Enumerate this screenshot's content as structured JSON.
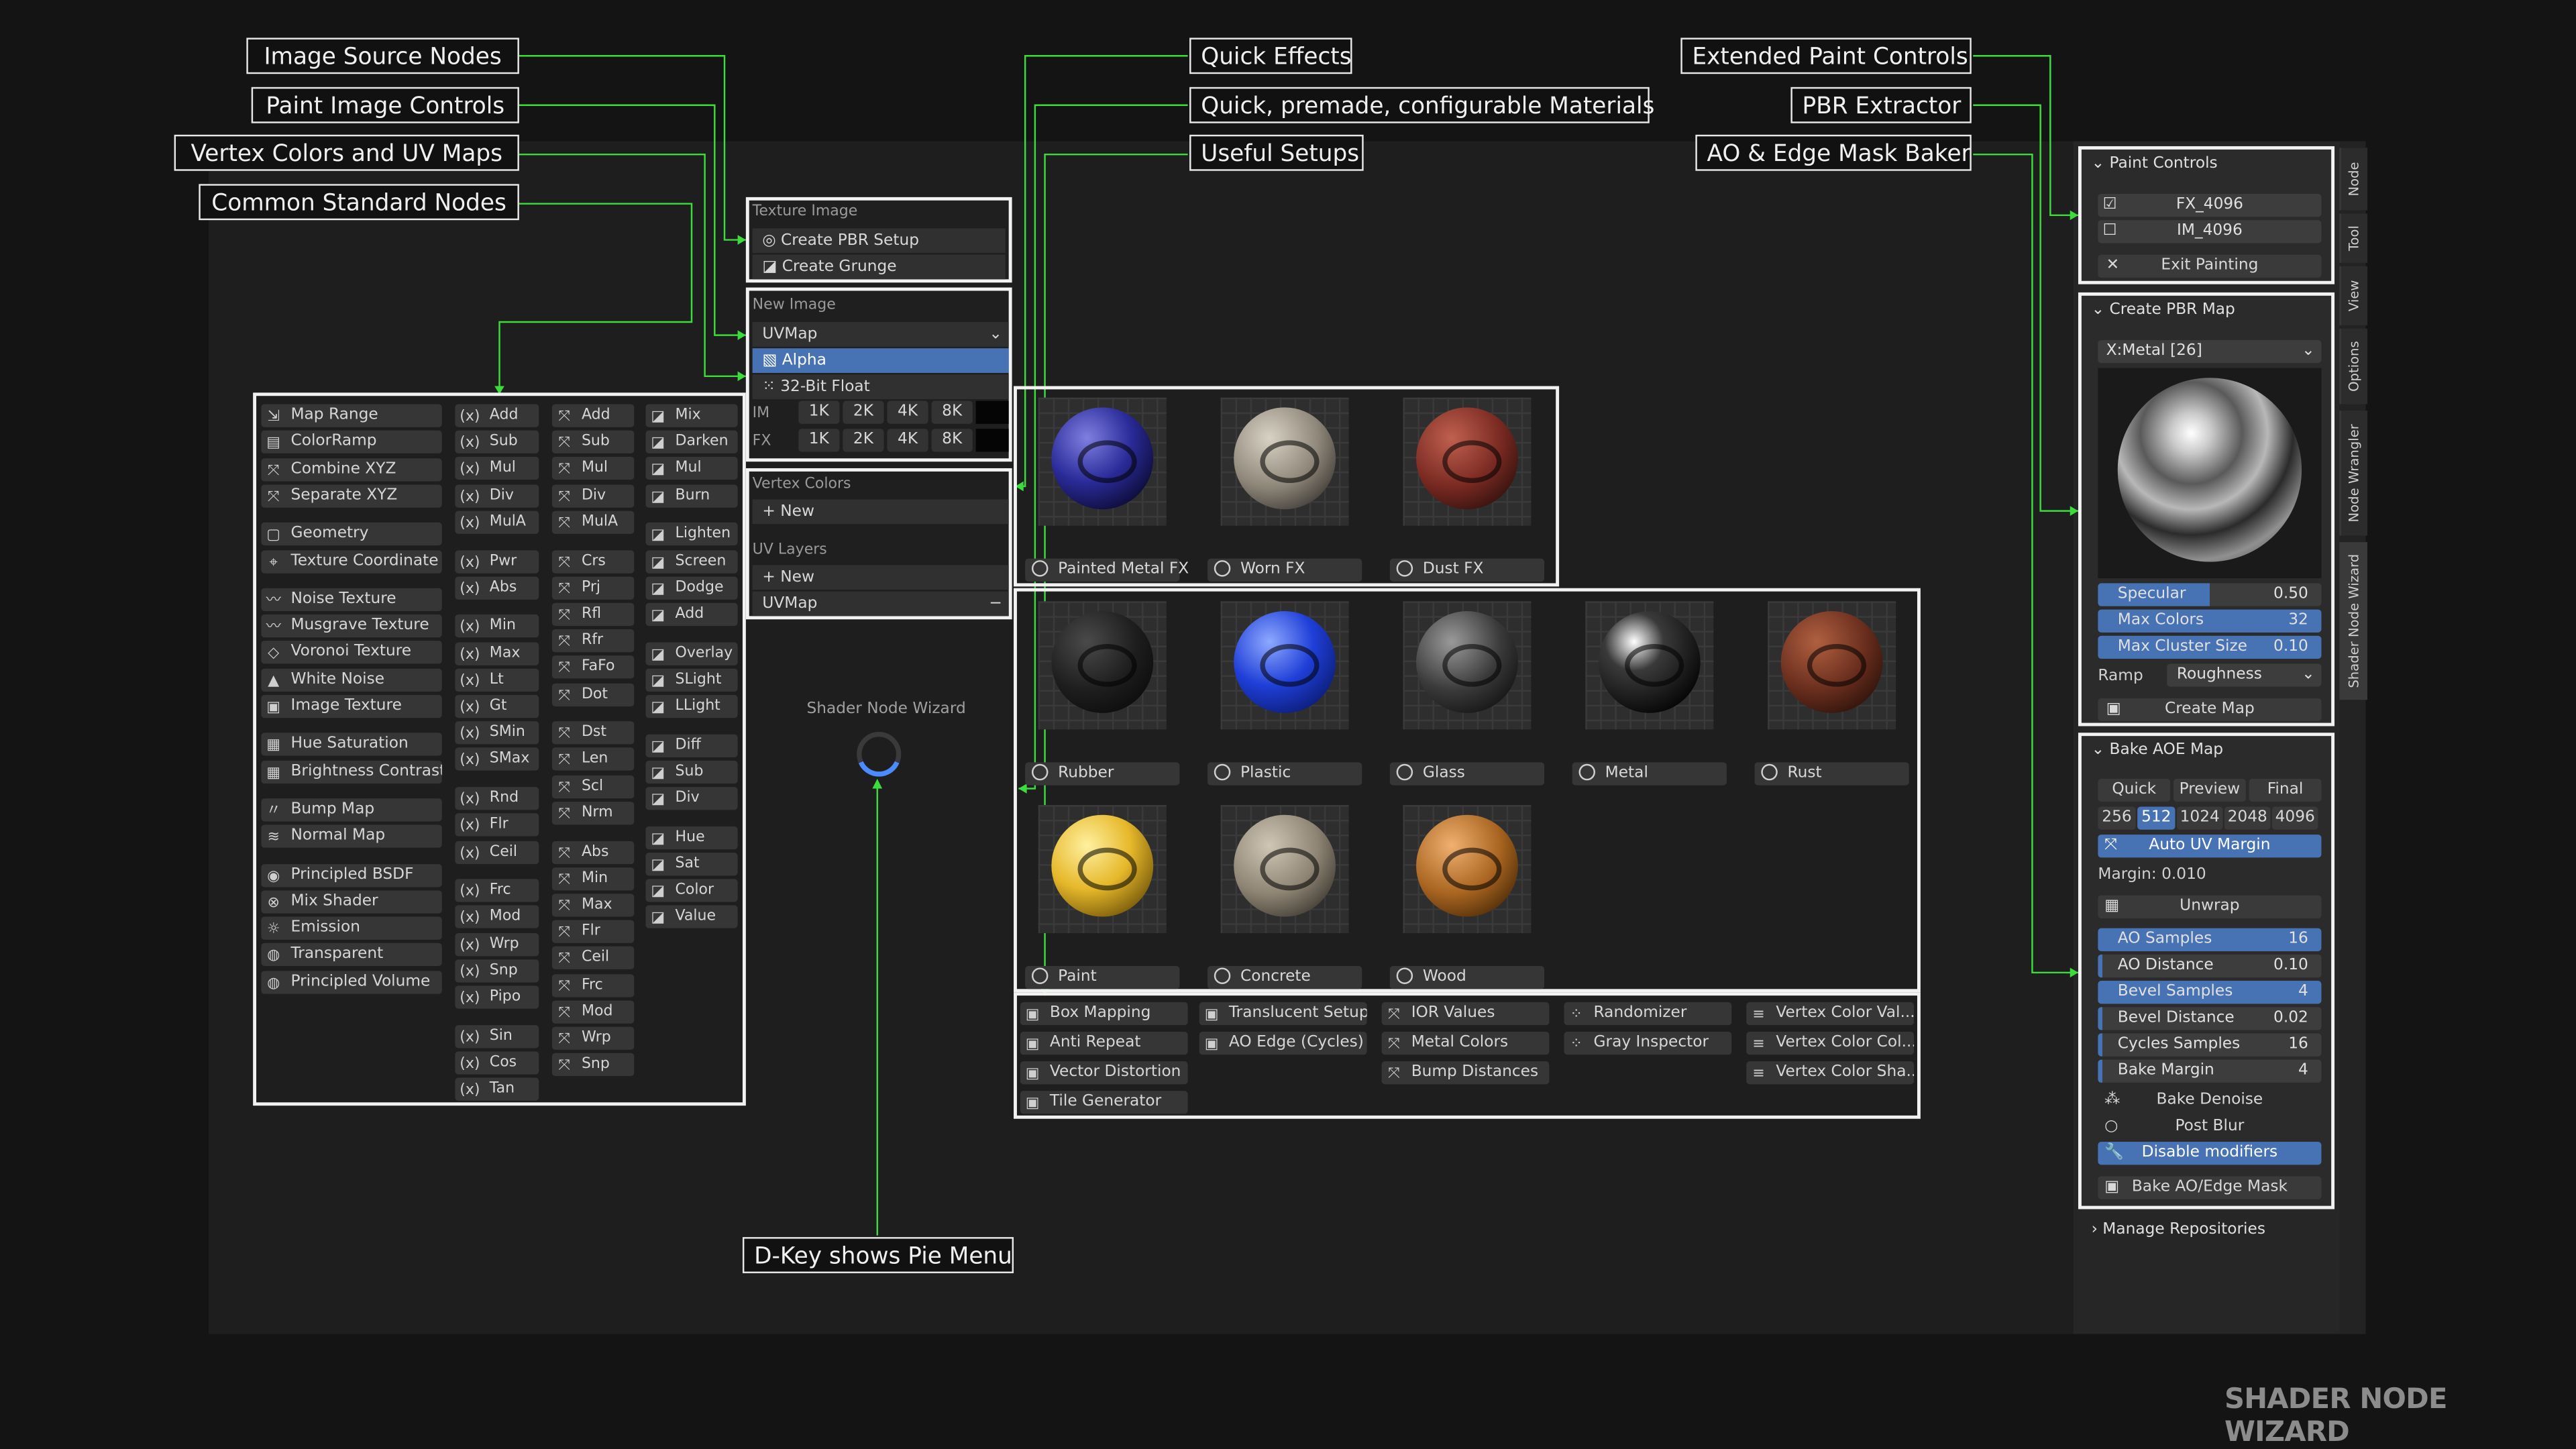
{
  "callouts": {
    "image_source_nodes": "Image Source Nodes",
    "paint_image_controls": "Paint Image Controls",
    "vertex_colors_uv_maps": "Vertex Colors and UV Maps",
    "common_standard_nodes": "Common Standard Nodes",
    "quick_effects": "Quick Effects",
    "quick_materials": "Quick, premade, configurable Materials",
    "useful_setups": "Useful Setups",
    "extended_paint_controls": "Extended Paint Controls",
    "pbr_extractor": "PBR Extractor",
    "ao_edge_mask_baker": "AO & Edge Mask Baker",
    "d_key_pie": "D-Key shows Pie Menu"
  },
  "nodes_col1": [
    "Map Range",
    "ColorRamp",
    "Combine XYZ",
    "Separate XYZ",
    "Geometry",
    "Texture Coordinate",
    "Noise Texture",
    "Musgrave Texture",
    "Voronoi Texture",
    "White Noise",
    "Image Texture",
    "Hue Saturation",
    "Brightness Contrast",
    "Bump Map",
    "Normal Map",
    "Principled BSDF",
    "Mix Shader",
    "Emission",
    "Transparent",
    "Principled Volume"
  ],
  "nodes_col2": [
    "Add",
    "Sub",
    "Mul",
    "Div",
    "MulA",
    "Pwr",
    "Abs",
    "Min",
    "Max",
    "Lt",
    "Gt",
    "SMin",
    "SMax",
    "Rnd",
    "Flr",
    "Ceil",
    "Frc",
    "Mod",
    "Wrp",
    "Snp",
    "Pipo",
    "Sin",
    "Cos",
    "Tan"
  ],
  "nodes_col3": [
    "Add",
    "Sub",
    "Mul",
    "Div",
    "MulA",
    "Crs",
    "Prj",
    "Rfl",
    "Rfr",
    "FaFo",
    "Dot",
    "Dst",
    "Len",
    "Scl",
    "Nrm",
    "Abs",
    "Min",
    "Max",
    "Flr",
    "Ceil",
    "Frc",
    "Mod",
    "Wrp",
    "Snp"
  ],
  "nodes_col4": [
    "Mix",
    "Darken",
    "Mul",
    "Burn",
    "Lighten",
    "Screen",
    "Dodge",
    "Add",
    "Overlay",
    "SLight",
    "LLight",
    "Diff",
    "Sub",
    "Div",
    "Hue",
    "Sat",
    "Color",
    "Value"
  ],
  "math_prefix": "(x)",
  "texture_image": {
    "title": "Texture Image",
    "items": [
      "Create PBR Setup",
      "Create Grunge"
    ]
  },
  "new_image": {
    "title": "New Image",
    "uvmap": "UVMap",
    "alpha": "Alpha",
    "float": "32-Bit Float",
    "im_label": "IM",
    "fx_label": "FX",
    "sizes": [
      "1K",
      "2K",
      "4K",
      "8K"
    ]
  },
  "vertex_colors": {
    "title": "Vertex Colors",
    "new": "New"
  },
  "uv_layers": {
    "title": "UV Layers",
    "new": "New",
    "item": "UVMap",
    "minus": "−"
  },
  "pie": {
    "label": "Shader Node Wizard"
  },
  "quick_effects": [
    "Painted Metal FX",
    "Worn FX",
    "Dust FX"
  ],
  "materials": [
    "Rubber",
    "Plastic",
    "Glass",
    "Metal",
    "Rust",
    "Paint",
    "Concrete",
    "Wood"
  ],
  "setups": {
    "col1": [
      "Box Mapping",
      "Anti Repeat",
      "Vector Distortion",
      "Tile Generator"
    ],
    "col2": [
      "Translucent Setup",
      "AO Edge (Cycles)"
    ],
    "col3": [
      "IOR Values",
      "Metal Colors",
      "Bump Distances"
    ],
    "col4": [
      "Randomizer",
      "Gray Inspector"
    ],
    "col5": [
      "Vertex Color Val...",
      "Vertex Color Col...",
      "Vertex Color Sha..."
    ]
  },
  "paint_controls": {
    "title": "Paint Controls",
    "fx": "FX_4096",
    "im": "IM_4096",
    "exit": "Exit Painting",
    "fx_checked": true,
    "im_checked": false
  },
  "pbr_map": {
    "title": "Create PBR Map",
    "preset": "X:Metal [26]",
    "specular_label": "Specular",
    "specular": "0.50",
    "max_colors_label": "Max Colors",
    "max_colors": "32",
    "cluster_label": "Max Cluster Size",
    "cluster": "0.10",
    "ramp_label": "Ramp",
    "ramp": "Roughness",
    "create": "Create Map"
  },
  "bake": {
    "title": "Bake AOE Map",
    "modes": [
      "Quick",
      "Preview",
      "Final"
    ],
    "sizes": [
      "256",
      "512",
      "1024",
      "2048",
      "4096"
    ],
    "selected_size": "512",
    "auto_uv": "Auto UV Margin",
    "margin": "Margin: 0.010",
    "unwrap": "Unwrap",
    "ao_samples_label": "AO Samples",
    "ao_samples": "16",
    "ao_distance_label": "AO Distance",
    "ao_distance": "0.10",
    "bevel_samples_label": "Bevel Samples",
    "bevel_samples": "4",
    "bevel_distance_label": "Bevel Distance",
    "bevel_distance": "0.02",
    "cycles_samples_label": "Cycles Samples",
    "cycles_samples": "16",
    "bake_margin_label": "Bake Margin",
    "bake_margin": "4",
    "denoise": "Bake Denoise",
    "post_blur": "Post Blur",
    "disable_mod": "Disable modifiers",
    "bake_btn": "Bake AO/Edge Mask"
  },
  "manage_repos": "Manage Repositories",
  "side_tabs": [
    "Node",
    "Tool",
    "View",
    "Options",
    "Node Wrangler",
    "Shader Node Wizard"
  ],
  "brand": "SHADER NODE WIZARD",
  "colors": {
    "accent": "#4772b3",
    "callout_line": "#3ddc3d",
    "panel_border": "#f2f2f2"
  }
}
